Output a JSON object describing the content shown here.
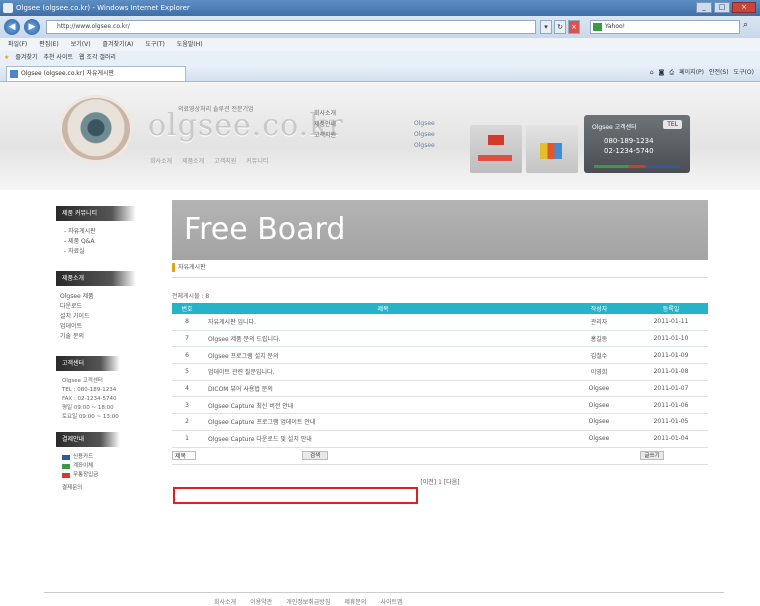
{
  "browser": {
    "title": "Olgsee (olgsee.co.kr) - Windows Internet Explorer",
    "url": "http://www.olgsee.co.kr/",
    "search_placeholder": "Yahoo!",
    "menu": [
      "파일(F)",
      "편집(E)",
      "보기(V)",
      "즐겨찾기(A)",
      "도구(T)",
      "도움말(H)"
    ],
    "favorites": [
      "즐겨찾기",
      "추천 사이트",
      "웹 조각 갤러리"
    ],
    "tab_title": "Olgsee (olgsee.co.kr) 자유게시판",
    "cmd": [
      "페이지(P)",
      "안전(S)",
      "도구(O)"
    ]
  },
  "site": {
    "logo": "olgsee.co.kr",
    "tagline": "의료영상처리 솔루션 전문기업",
    "logo_sub": [
      "회사소개",
      "제품소개",
      "고객지원",
      "커뮤니티"
    ],
    "header_menu": [
      "회사소개",
      "제품안내",
      "",
      "고객지원"
    ],
    "header_menu2": [
      "Olgsee",
      "Olgsee",
      "Olgsee"
    ],
    "contact_title": "Olgsee 고객센터",
    "contact_badge": "TEL",
    "contact_phone1": "080-189-1234",
    "contact_phone2": "02-1234-5740"
  },
  "sidebar": {
    "section1_title": "제품 커뮤니티",
    "section1_items": [
      "- 자유게시판",
      "- 제품 Q&A",
      "- 자료실"
    ],
    "section2_title": "제품소개",
    "section2_items": [
      "Olgsee 제품",
      "다운로드",
      "설치 가이드",
      "업데이트",
      "기술 문의"
    ],
    "support_title": "고객센터",
    "support_lines": [
      "Olgsee 고객센터",
      "TEL : 080-189-1234",
      "FAX : 02-1234-5740",
      "평일 09:00 ~ 18:00",
      "토요일 09:00 ~ 13:00"
    ],
    "payment_title": "결제안내",
    "payment_items": [
      "신용카드",
      "계좌이체",
      "무통장입금"
    ],
    "payment_colors": [
      "#2d5aa6",
      "#3b9a47",
      "#d23a2a"
    ],
    "payment_note": "결제문의"
  },
  "board": {
    "title": "Free Board",
    "crumb": "자유게시판",
    "count_text": "전체게시물 : 8",
    "columns": [
      "번호",
      "제목",
      "작성자",
      "등록일"
    ],
    "rows": [
      {
        "no": "8",
        "subject": "자유게시판 입니다.",
        "writer": "관리자",
        "date": "2011-01-11"
      },
      {
        "no": "7",
        "subject": "Olgsee 제품 문의 드립니다.",
        "writer": "홍길동",
        "date": "2011-01-10"
      },
      {
        "no": "6",
        "subject": "Olgsee 프로그램 설치 문의",
        "writer": "김철수",
        "date": "2011-01-09"
      },
      {
        "no": "5",
        "subject": "업데이트 관련 질문입니다.",
        "writer": "이영희",
        "date": "2011-01-08"
      },
      {
        "no": "4",
        "subject": "DICOM 뷰어 사용법 문의",
        "writer": "Olgsee",
        "date": "2011-01-07"
      },
      {
        "no": "3",
        "subject": "Olgsee Capture 최신 버전 안내",
        "writer": "Olgsee",
        "date": "2011-01-06"
      },
      {
        "no": "2",
        "subject": "Olgsee Capture 프로그램 업데이트 안내",
        "writer": "Olgsee",
        "date": "2011-01-05"
      },
      {
        "no": "1",
        "subject": "Olgsee Capture 다운로드 및 설치 안내",
        "writer": "Olgsee",
        "date": "2011-01-04"
      }
    ],
    "search_select": "제목",
    "search_button": "검색",
    "write_button": "글쓰기",
    "pager": [
      "[이전]",
      "1",
      "[다음]"
    ]
  },
  "footer": {
    "links": [
      "회사소개",
      "이용약관",
      "개인정보취급방침",
      "제휴문의",
      "사이트맵"
    ]
  },
  "colors": {
    "table_header": "#26b3c8",
    "highlight": "#e02020",
    "crumb_accent": "#e3a321"
  }
}
